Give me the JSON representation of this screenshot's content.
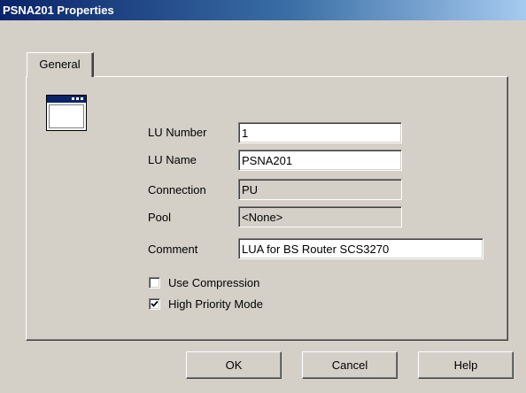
{
  "window": {
    "title": "PSNA201 Properties"
  },
  "tabs": [
    {
      "label": "General"
    }
  ],
  "form": {
    "lu_number": {
      "label": "LU Number",
      "value": "1"
    },
    "lu_name": {
      "label": "LU Name",
      "value": "PSNA201"
    },
    "connection": {
      "label": "Connection",
      "value": "PU"
    },
    "pool": {
      "label": "Pool",
      "value": "<None>"
    },
    "comment": {
      "label": "Comment",
      "value": "LUA for BS Router SCS3270"
    }
  },
  "options": {
    "use_compression": {
      "label": "Use Compression",
      "checked": false
    },
    "high_priority_mode": {
      "label": "High Priority Mode",
      "checked": true
    }
  },
  "buttons": {
    "ok": "OK",
    "cancel": "Cancel",
    "help": "Help"
  },
  "icons": {
    "app": "application-window-icon",
    "check": "checkmark-icon"
  },
  "colors": {
    "titlebar_start": "#0a246a",
    "titlebar_end": "#a6caf0",
    "face": "#d4d0c8"
  }
}
